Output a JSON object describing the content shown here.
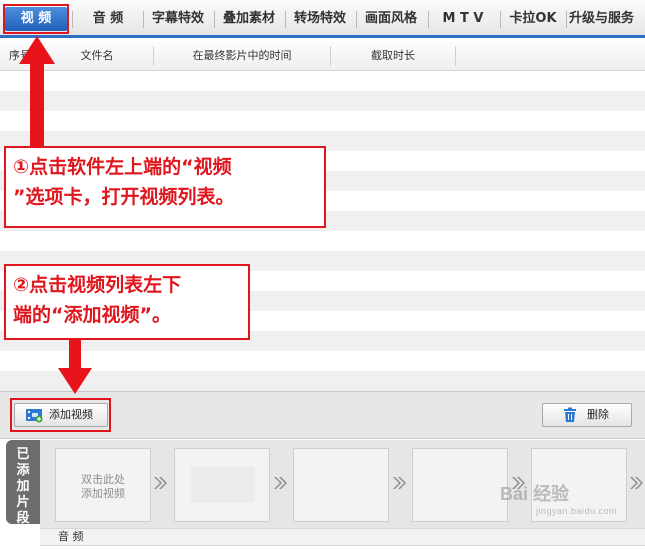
{
  "tabs": [
    "视 频",
    "音 频",
    "字幕特效",
    "叠加素材",
    "转场特效",
    "画面风格",
    "M T V",
    "卡拉OK",
    "升级与服务"
  ],
  "table": {
    "headers": [
      "序号",
      "文件名",
      "在最终影片中的时间",
      "截取时长"
    ]
  },
  "toolbar": {
    "add_video": "添加视频",
    "delete": "删除"
  },
  "strip": {
    "label": "已添加片段",
    "first_clip_hint_line1": "双击此处",
    "first_clip_hint_line2": "添加视频",
    "audio_label": "音 频"
  },
  "annotations": {
    "step1": "①点击软件左上端的“视频”选项卡，打开视频列表。",
    "step1_line1": "①点击软件左上端的“视频",
    "step1_line2": "”选项卡，打开视频列表。",
    "step2_line1": "②点击视频列表左下",
    "step2_line2": "端的“添加视频”。"
  },
  "watermark": {
    "brand": "Bai 经验",
    "url": "jingyan.baidu.com"
  },
  "colors": {
    "accent_blue": "#2d6fc4",
    "annotation_red": "#e0161e"
  }
}
